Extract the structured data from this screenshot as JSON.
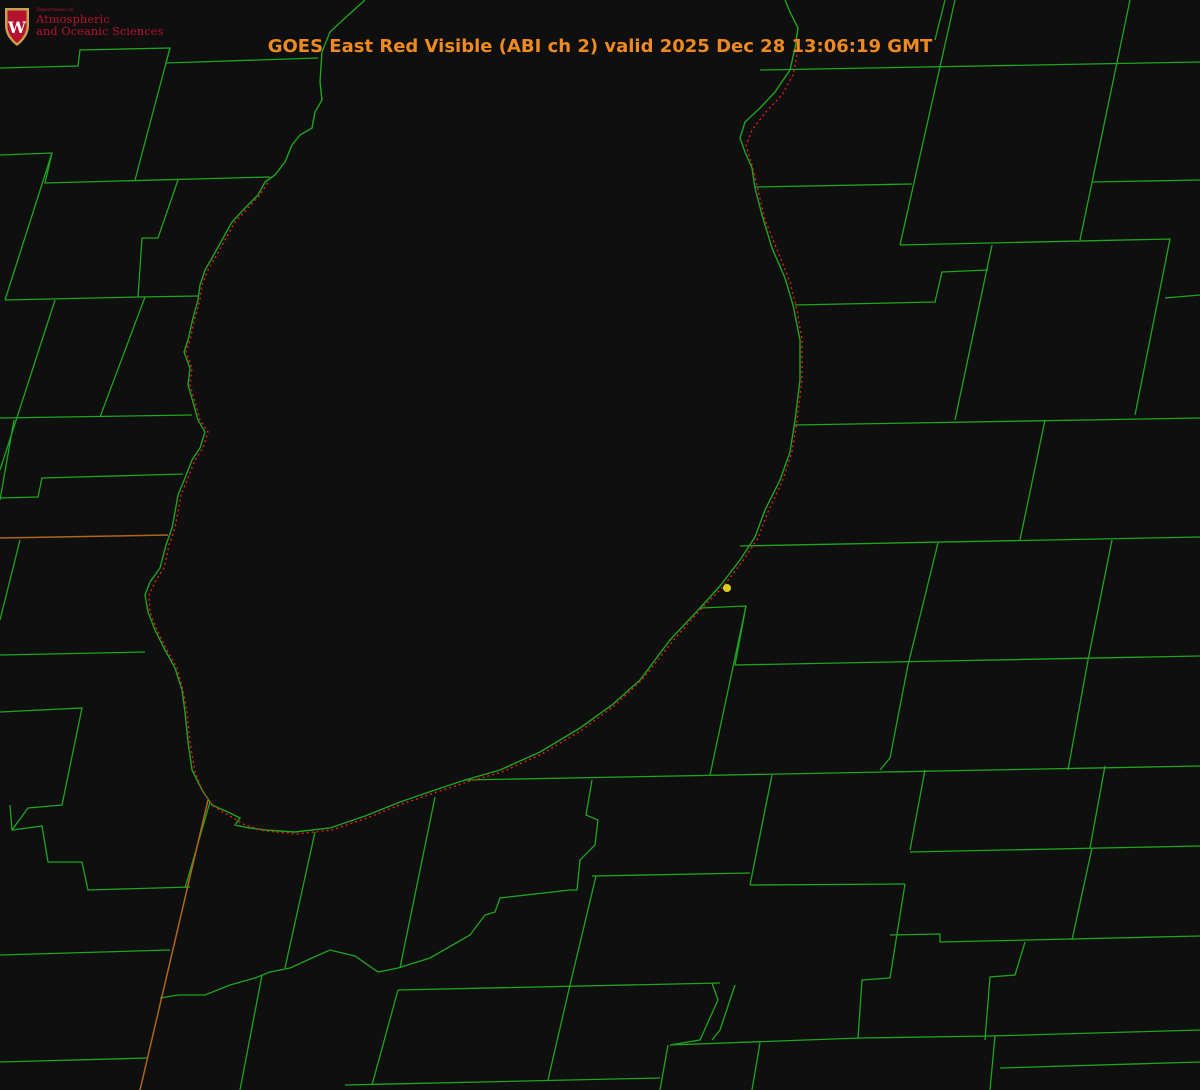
{
  "title": "GOES East Red Visible (ABI ch 2) valid 2025 Dec 28 13:06:19 GMT",
  "logo": {
    "shield_letter": "W",
    "line1": "Department of",
    "line2": "Atmospheric",
    "line3": "and Oceanic Sciences"
  },
  "colors": {
    "background": "#0f0f0f",
    "county_lines": "#1fa51f",
    "shoreline_dotted": "#e0201e",
    "state_line": "#b0661c",
    "title": "#ee8a1f",
    "station_marker": "#d8cc20",
    "logo_red": "#b5122e",
    "logo_gold": "#c9a04b"
  },
  "icons": {
    "logo": "uw-crest-icon",
    "station": "station-dot-icon"
  }
}
